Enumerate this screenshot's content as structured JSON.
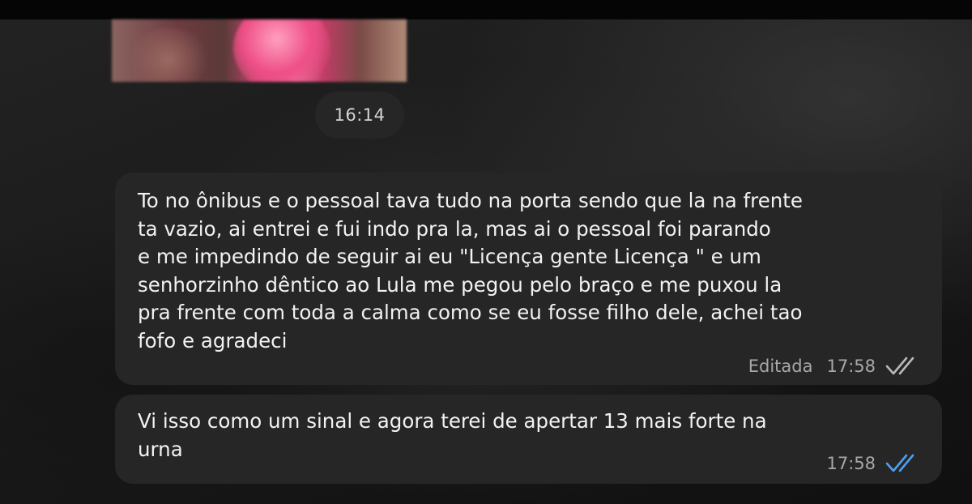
{
  "chat": {
    "divider_time": "16:14",
    "messages": [
      {
        "text": "To no ônibus e o pessoal tava tudo na porta sendo que la na frente\nta vazio, ai entrei e fui indo pra la, mas ai o pessoal foi parando\ne me impedindo de seguir ai eu \"Licença gente Licença \" e um\nsenhorzinho dêntico ao Lula me pegou pelo braço e me puxou la\npra frente com toda a calma como se eu fosse filho dele, achei tao\nfofo e agradeci",
        "edited_label": "Editada",
        "time": "17:58",
        "status_icon": "double-check-icon",
        "status_color": "#b9b9b9"
      },
      {
        "text": "Vi isso como um sinal e agora terei de apertar 13 mais forte na\nurna",
        "time": "17:58",
        "status_icon": "double-check-read-icon",
        "status_color": "#4f9ff0"
      }
    ]
  }
}
